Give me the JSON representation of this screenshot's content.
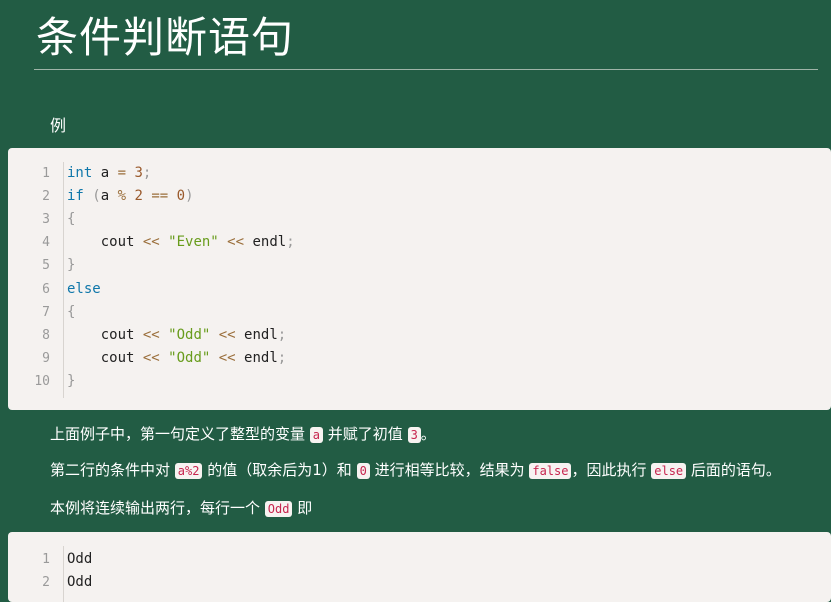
{
  "page": {
    "title": "条件判断语句",
    "example_label": "例"
  },
  "code_example": {
    "lines": [
      {
        "n": "1",
        "tokens": [
          [
            "kw",
            "int"
          ],
          [
            "txt",
            " a "
          ],
          [
            "op",
            "="
          ],
          [
            "txt",
            " "
          ],
          [
            "num",
            "3"
          ],
          [
            "punc",
            ";"
          ]
        ]
      },
      {
        "n": "2",
        "tokens": [
          [
            "kw",
            "if"
          ],
          [
            "txt",
            " "
          ],
          [
            "punc",
            "("
          ],
          [
            "txt",
            "a "
          ],
          [
            "op",
            "%"
          ],
          [
            "txt",
            " "
          ],
          [
            "num",
            "2"
          ],
          [
            "txt",
            " "
          ],
          [
            "op",
            "=="
          ],
          [
            "txt",
            " "
          ],
          [
            "num",
            "0"
          ],
          [
            "punc",
            ")"
          ]
        ]
      },
      {
        "n": "3",
        "tokens": [
          [
            "punc",
            "{"
          ]
        ]
      },
      {
        "n": "4",
        "tokens": [
          [
            "txt",
            "    cout "
          ],
          [
            "op",
            "<<"
          ],
          [
            "txt",
            " "
          ],
          [
            "str",
            "\"Even\""
          ],
          [
            "txt",
            " "
          ],
          [
            "op",
            "<<"
          ],
          [
            "txt",
            " endl"
          ],
          [
            "punc",
            ";"
          ]
        ]
      },
      {
        "n": "5",
        "tokens": [
          [
            "punc",
            "}"
          ]
        ]
      },
      {
        "n": "6",
        "tokens": [
          [
            "kw",
            "else"
          ]
        ]
      },
      {
        "n": "7",
        "tokens": [
          [
            "punc",
            "{"
          ]
        ]
      },
      {
        "n": "8",
        "tokens": [
          [
            "txt",
            "    cout "
          ],
          [
            "op",
            "<<"
          ],
          [
            "txt",
            " "
          ],
          [
            "str",
            "\"Odd\""
          ],
          [
            "txt",
            " "
          ],
          [
            "op",
            "<<"
          ],
          [
            "txt",
            " endl"
          ],
          [
            "punc",
            ";"
          ]
        ]
      },
      {
        "n": "9",
        "tokens": [
          [
            "txt",
            "    cout "
          ],
          [
            "op",
            "<<"
          ],
          [
            "txt",
            " "
          ],
          [
            "str",
            "\"Odd\""
          ],
          [
            "txt",
            " "
          ],
          [
            "op",
            "<<"
          ],
          [
            "txt",
            " endl"
          ],
          [
            "punc",
            ";"
          ]
        ]
      },
      {
        "n": "10",
        "tokens": [
          [
            "punc",
            "}"
          ]
        ]
      }
    ]
  },
  "paragraphs": {
    "p1": [
      "上面例子中，第一句定义了整型的变量 ",
      "a",
      " 并赋了初值 ",
      "3",
      "。"
    ],
    "p2": [
      "第二行的条件中对 ",
      "a%2",
      " 的值（取余后为1）和 ",
      "0",
      " 进行相等比较，结果为 ",
      "false",
      "，因此执行 ",
      "else",
      " 后面的语句。"
    ],
    "p3": [
      "本例将连续输出两行，每行一个 ",
      "Odd",
      " 即"
    ]
  },
  "output_example": {
    "lines": [
      {
        "n": "1",
        "text": "Odd"
      },
      {
        "n": "2",
        "text": "Odd"
      }
    ]
  }
}
